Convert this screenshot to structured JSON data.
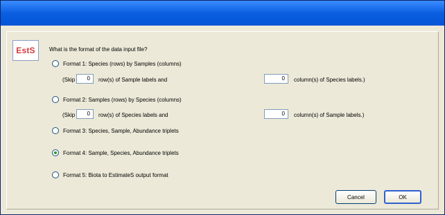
{
  "logo_text": "EstS",
  "question": "What is the format of the data input file?",
  "formats": [
    {
      "label": "Format 1: Species (rows) by Samples (columns)",
      "checked": false
    },
    {
      "label": "Format 2: Samples (rows) by Species (columns)",
      "checked": false
    },
    {
      "label": "Format 3: Species, Sample, Abundance triplets",
      "checked": true
    },
    {
      "label": "Format 4: Sample, Species, Abundance triplets",
      "checked": true
    },
    {
      "label": "Format 5: Biota to EstimateS output format",
      "checked": false
    }
  ],
  "format1": {
    "skip_prefix": "(Skip",
    "row_value": "0",
    "row_text": "row(s) of Sample labels and",
    "col_value": "0",
    "col_text": "column(s) of Species labels.)"
  },
  "format2": {
    "skip_prefix": "(Skip",
    "row_value": "0",
    "row_text": "row(s) of Species labels and",
    "col_value": "0",
    "col_text": "column(s) of Sample labels.)"
  },
  "buttons": {
    "cancel": "Cancel",
    "ok": "OK"
  }
}
